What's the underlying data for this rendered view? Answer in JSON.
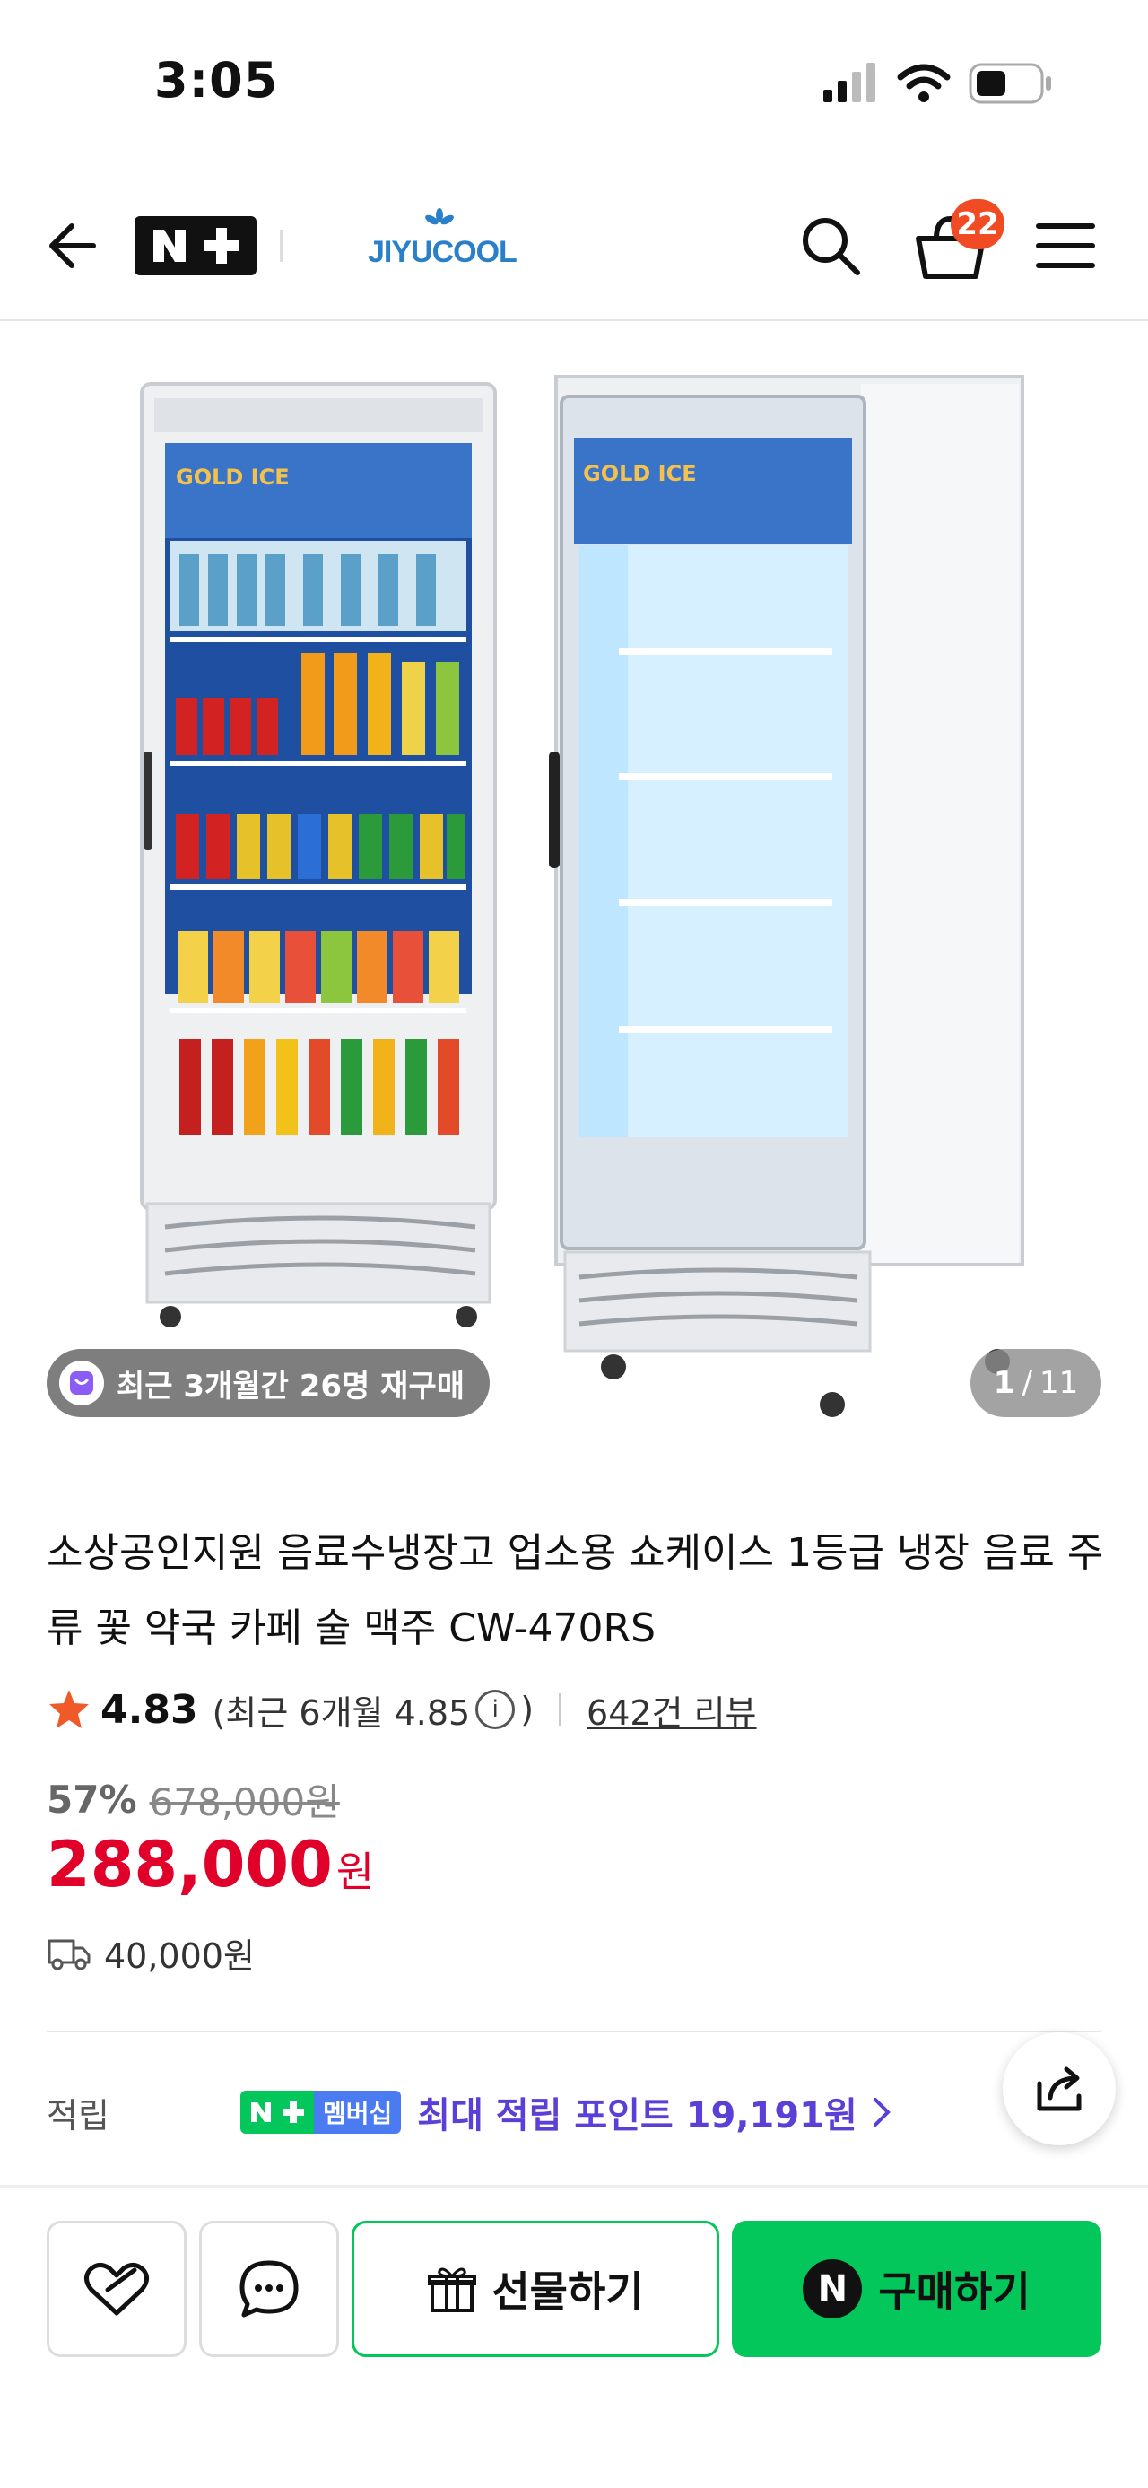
{
  "status_bar": {
    "time": "3:05"
  },
  "header": {
    "brand_logo_text": "JIYUCOOL",
    "cart_count": "22"
  },
  "gallery": {
    "repurchase_badge": "최근 3개월간 26명 재구매",
    "current_index": "1",
    "separator": "/",
    "total": "11",
    "fridge_label": "GOLD ICE"
  },
  "product": {
    "title": "소상공인지원 음료수냉장고 업소용 쇼케이스 1등급 냉장 음료 주류 꽃 약국 카페 술 맥주 CW-470RS",
    "rating": "4.83",
    "recent_rating_prefix": "(최근 6개월 4.85",
    "recent_rating_suffix": ")",
    "review_count": "642건 리뷰",
    "discount_rate": "57%",
    "original_price": "678,000원",
    "sale_price": "288,000",
    "sale_currency": "원",
    "shipping_fee": "40,000원"
  },
  "points": {
    "label": "적립",
    "membership_badge": "멤버십",
    "text": "최대 적립 포인트 19,191원"
  },
  "bottom_bar": {
    "gift_label": "선물하기",
    "buy_label": "구매하기",
    "buy_badge": "N"
  },
  "colors": {
    "accent_green": "#03c75a",
    "price_red": "#e0002a",
    "points_purple": "#5b3fd6",
    "cart_badge": "#f04b23"
  }
}
